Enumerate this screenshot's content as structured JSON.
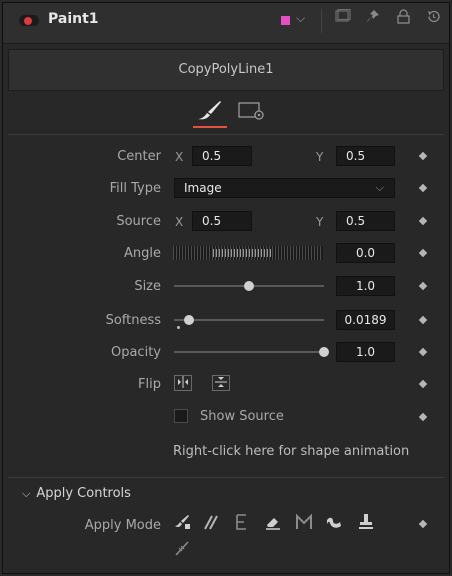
{
  "header": {
    "title": "Paint1",
    "swatch_color": "#e64fc2",
    "accent": "#e0383d",
    "icons": [
      "chevron-down-icon",
      "view-icon",
      "pin-icon",
      "lock-icon",
      "reset-icon"
    ]
  },
  "module_title": "CopyPolyLine1",
  "tabs": [
    {
      "name": "paint-brush-tab-icon",
      "active": true
    },
    {
      "name": "settings-tab-icon",
      "active": false
    }
  ],
  "params": {
    "center": {
      "label": "Center",
      "x_axis": "X",
      "x": "0.5",
      "y_axis": "Y",
      "y": "0.5"
    },
    "fill_type": {
      "label": "Fill Type",
      "value": "Image"
    },
    "source": {
      "label": "Source",
      "x_axis": "X",
      "x": "0.5",
      "y_axis": "Y",
      "y": "0.5"
    },
    "angle": {
      "label": "Angle",
      "value": "0.0"
    },
    "size": {
      "label": "Size",
      "value": "1.0",
      "fraction": 0.5
    },
    "softness": {
      "label": "Softness",
      "value": "0.0189",
      "fraction": 0.1
    },
    "opacity": {
      "label": "Opacity",
      "value": "1.0",
      "fraction": 1.0
    },
    "flip": {
      "label": "Flip"
    },
    "show_source": {
      "label": "Show Source",
      "checked": false
    }
  },
  "hint": "Right-click here for shape animation",
  "apply": {
    "section_label": "Apply Controls",
    "mode_label": "Apply Mode",
    "modes": [
      "color-mode-icon",
      "clone-mode-icon",
      "emboss-mode-icon",
      "erase-mode-icon",
      "merge-mode-icon",
      "smear-mode-icon",
      "stamp-mode-icon",
      "wire-mode-icon"
    ]
  }
}
